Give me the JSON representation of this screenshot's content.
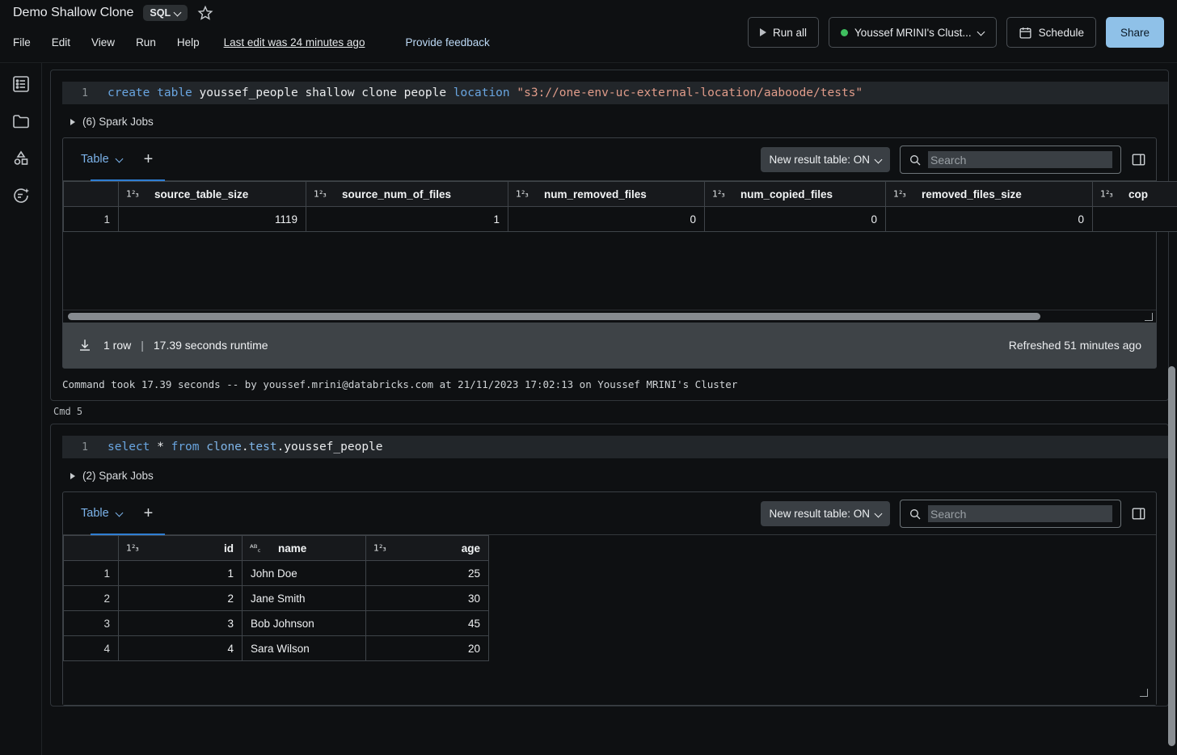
{
  "header": {
    "doc_title": "Demo Shallow Clone",
    "language_badge": "SQL",
    "star_icon": "star-icon",
    "menu": [
      "File",
      "Edit",
      "View",
      "Run",
      "Help"
    ],
    "last_edit": "Last edit was 24 minutes ago",
    "feedback": "Provide feedback",
    "run_all": "Run all",
    "cluster": "Youssef MRINI's Clust...",
    "cluster_status_color": "#3fbf5f",
    "schedule": "Schedule",
    "share": "Share",
    "share_bg": "#8fc1e8"
  },
  "rail": {
    "items": [
      {
        "name": "table-of-contents-icon",
        "label": "Table of contents"
      },
      {
        "name": "folder-icon",
        "label": "Workspace"
      },
      {
        "name": "catalog-shapes-icon",
        "label": "Catalog"
      },
      {
        "name": "assistant-sparkle-icon",
        "label": "Assistant"
      }
    ]
  },
  "cells": [
    {
      "cmd_label": "",
      "line_number": "1",
      "code_tokens": [
        {
          "t": "create",
          "c": "kw"
        },
        {
          "t": " ",
          "c": "plain"
        },
        {
          "t": "table",
          "c": "kw"
        },
        {
          "t": " youssef_people shallow clone people ",
          "c": "plain"
        },
        {
          "t": "location",
          "c": "kw"
        },
        {
          "t": " ",
          "c": "plain"
        },
        {
          "t": "\"s3://one-env-uc-external-location/aaboode/tests\"",
          "c": "str"
        }
      ],
      "spark_jobs": "(6) Spark Jobs",
      "result": {
        "tab_label": "Table",
        "add_tab_icon": "plus-icon",
        "new_result_table": "New result table: ON",
        "search_placeholder": "Search",
        "search_value": "",
        "panel_toggle_icon": "side-panel-icon",
        "columns": [
          {
            "name": "source_table_size",
            "type": "number"
          },
          {
            "name": "source_num_of_files",
            "type": "number"
          },
          {
            "name": "num_removed_files",
            "type": "number"
          },
          {
            "name": "num_copied_files",
            "type": "number"
          },
          {
            "name": "removed_files_size",
            "type": "number"
          },
          {
            "name": "cop",
            "type": "number"
          }
        ],
        "rows": [
          {
            "num": "1",
            "values": [
              "1119",
              "1",
              "0",
              "0",
              "0",
              ""
            ]
          }
        ],
        "row_count": "1 row",
        "runtime": "17.39 seconds runtime",
        "refreshed": "Refreshed 51 minutes ago",
        "download_icon": "download-icon"
      },
      "cmd_meta": "Command took 17.39 seconds -- by youssef.mrini@databricks.com at 21/11/2023 17:02:13 on Youssef MRINI's Cluster"
    },
    {
      "cmd_label": "Cmd 5",
      "line_number": "1",
      "code_tokens": [
        {
          "t": "select",
          "c": "kw"
        },
        {
          "t": " ",
          "c": "plain"
        },
        {
          "t": "*",
          "c": "plain"
        },
        {
          "t": " ",
          "c": "plain"
        },
        {
          "t": "from",
          "c": "kw"
        },
        {
          "t": " ",
          "c": "plain"
        },
        {
          "t": "clone",
          "c": "idf"
        },
        {
          "t": ".",
          "c": "plain"
        },
        {
          "t": "test",
          "c": "idf"
        },
        {
          "t": ".youssef_people",
          "c": "plain"
        }
      ],
      "spark_jobs": "(2) Spark Jobs",
      "result": {
        "tab_label": "Table",
        "add_tab_icon": "plus-icon",
        "new_result_table": "New result table: ON",
        "search_placeholder": "Search",
        "search_value": "",
        "panel_toggle_icon": "side-panel-icon",
        "columns": [
          {
            "name": "id",
            "type": "number"
          },
          {
            "name": "name",
            "type": "string"
          },
          {
            "name": "age",
            "type": "number"
          }
        ],
        "rows": [
          {
            "num": "1",
            "values": [
              "1",
              "John Doe",
              "25"
            ]
          },
          {
            "num": "2",
            "values": [
              "2",
              "Jane Smith",
              "30"
            ]
          },
          {
            "num": "3",
            "values": [
              "3",
              "Bob Johnson",
              "45"
            ]
          },
          {
            "num": "4",
            "values": [
              "4",
              "Sara Wilson",
              "20"
            ]
          }
        ]
      }
    }
  ],
  "icons": {
    "number_type": "1²₃",
    "string_type": "ᴬᴮ꜀"
  }
}
